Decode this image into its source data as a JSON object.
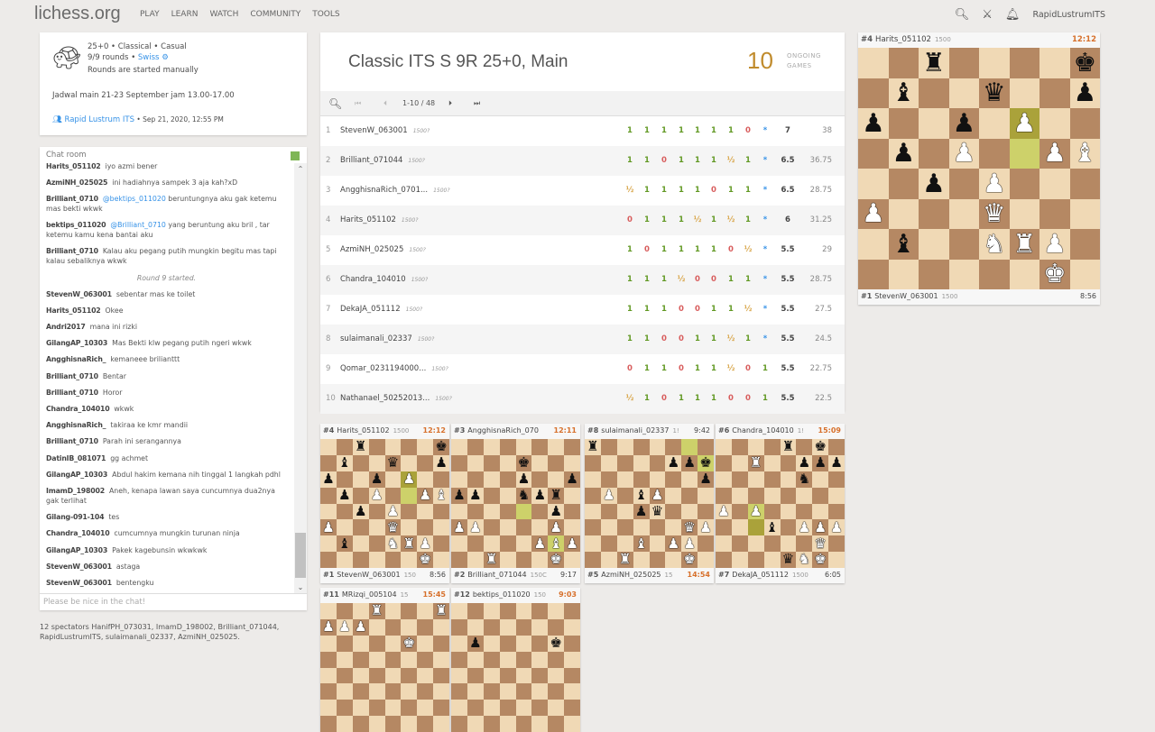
{
  "header": {
    "logo": "lichess.org",
    "nav": [
      "PLAY",
      "LEARN",
      "WATCH",
      "COMMUNITY",
      "TOOLS"
    ],
    "user": "RapidLustrumITS"
  },
  "info": {
    "line1": "25+0 • Classical • Casual",
    "rounds": "9/9 rounds • ",
    "swiss": "Swiss",
    "line3": "Rounds are started manually",
    "desc": "Jadwal main 21-23 September jam 13.00-17.00",
    "team": "Rapid Lustrum ITS",
    "date": " • Sep 21, 2020, 12:55 PM"
  },
  "chat": {
    "title": "Chat room",
    "placeholder": "Please be nice in the chat!",
    "messages": [
      {
        "u": "Harits_051102",
        "t": "iyo azmi bener"
      },
      {
        "u": "AzmiNH_025025",
        "t": "ini hadiahnya sampek 3 aja kah?xD"
      },
      {
        "u": "Brilliant_0710",
        "m": "@bektips_011020",
        "t": " beruntungnya aku gak ketemu mas bekti wkwk"
      },
      {
        "u": "bektips_011020",
        "m": "@Brilliant_0710",
        "t": " yang beruntung aku bril , tar ketemu kamu kena bantai aku"
      },
      {
        "u": "Brilliant_0710",
        "t": "Kalau aku pegang putih mungkin begitu mas tapi kalau sebaliknya wkwk"
      },
      {
        "sys": "Round 9 started."
      },
      {
        "u": "StevenW_063001",
        "t": "sebentar mas ke toilet"
      },
      {
        "u": "Harits_051102",
        "t": "Okee"
      },
      {
        "u": "Andri2017",
        "t": "mana ini rizki"
      },
      {
        "u": "GilangAP_10303",
        "t": "Mas Bekti klw pegang putih ngeri wkwk"
      },
      {
        "u": "AngghisnaRich_",
        "t": "kemaneee brilianttt"
      },
      {
        "u": "Brilliant_0710",
        "t": "Bentar"
      },
      {
        "u": "Brilliant_0710",
        "t": "Horor"
      },
      {
        "u": "Chandra_104010",
        "t": "wkwk"
      },
      {
        "u": "AngghisnaRich_",
        "t": "takiraa ke kmr mandii"
      },
      {
        "u": "Brilliant_0710",
        "t": "Parah ini serangannya"
      },
      {
        "u": "DatinIB_081071",
        "t": "gg achmet"
      },
      {
        "u": "GilangAP_10303",
        "t": "Abdul hakim kemana nih tinggal 1 langkah pdhl"
      },
      {
        "u": "ImamD_198002",
        "t": "Aneh, kenapa lawan saya cuncumnya dua2nya gak terlihat"
      },
      {
        "u": "Gilang-091-104",
        "t": "tes"
      },
      {
        "u": "Chandra_104010",
        "t": "cumcumnya mungkin turunan ninja"
      },
      {
        "u": "GilangAP_10303",
        "t": "Pakek kagebunsin wkwkwk"
      },
      {
        "u": "StevenW_063001",
        "t": "astaga"
      },
      {
        "u": "StevenW_063001",
        "t": "bentengku"
      }
    ]
  },
  "spectators": "12 spectators HanifPH_073031, ImamD_198002, Brilliant_071044, RapidLustrumITS, sulaimanali_02337, AzmiNH_025025.",
  "tournament": {
    "title": "Classic ITS S 9R 25+0, Main",
    "ongoing": "10",
    "ongoing_label1": "ONGOING",
    "ongoing_label2": "GAMES",
    "pager": "1-10 / 48"
  },
  "standings": [
    {
      "rank": "1",
      "name": "StevenW_063001",
      "rating": "1500?",
      "res": [
        "1",
        "1",
        "1",
        "1",
        "1",
        "1",
        "1",
        "0",
        "*"
      ],
      "total": "7",
      "tb": "38"
    },
    {
      "rank": "2",
      "name": "Brilliant_071044",
      "rating": "1500?",
      "res": [
        "1",
        "1",
        "0",
        "1",
        "1",
        "1",
        "½",
        "1",
        "*"
      ],
      "total": "6.5",
      "tb": "36.75"
    },
    {
      "rank": "3",
      "name": "AngghisnaRich_0701...",
      "rating": "1500?",
      "res": [
        "½",
        "1",
        "1",
        "1",
        "1",
        "0",
        "1",
        "1",
        "*"
      ],
      "total": "6.5",
      "tb": "28.75"
    },
    {
      "rank": "4",
      "name": "Harits_051102",
      "rating": "1500?",
      "res": [
        "0",
        "1",
        "1",
        "1",
        "½",
        "1",
        "½",
        "1",
        "*"
      ],
      "total": "6",
      "tb": "31.25"
    },
    {
      "rank": "5",
      "name": "AzmiNH_025025",
      "rating": "1500?",
      "res": [
        "1",
        "0",
        "1",
        "1",
        "1",
        "1",
        "0",
        "½",
        "*"
      ],
      "total": "5.5",
      "tb": "29"
    },
    {
      "rank": "6",
      "name": "Chandra_104010",
      "rating": "1500?",
      "res": [
        "1",
        "1",
        "1",
        "½",
        "0",
        "0",
        "1",
        "1",
        "*"
      ],
      "total": "5.5",
      "tb": "28.75"
    },
    {
      "rank": "7",
      "name": "DekaJA_051112",
      "rating": "1500?",
      "res": [
        "1",
        "1",
        "1",
        "0",
        "0",
        "1",
        "1",
        "½",
        "*"
      ],
      "total": "5.5",
      "tb": "27.5"
    },
    {
      "rank": "8",
      "name": "sulaimanali_02337",
      "rating": "1500?",
      "res": [
        "1",
        "1",
        "0",
        "0",
        "1",
        "1",
        "½",
        "1",
        "*"
      ],
      "total": "5.5",
      "tb": "24.5"
    },
    {
      "rank": "9",
      "name": "Qomar_0231194000...",
      "rating": "1500?",
      "res": [
        "0",
        "1",
        "1",
        "0",
        "1",
        "1",
        "½",
        "0",
        "1"
      ],
      "total": "5.5",
      "tb": "22.75"
    },
    {
      "rank": "10",
      "name": "Nathanael_50252013...",
      "rating": "1500?",
      "res": [
        "½",
        "1",
        "0",
        "1",
        "1",
        "1",
        "0",
        "0",
        "1"
      ],
      "total": "5.5",
      "tb": "22.5"
    }
  ],
  "featured": {
    "top": {
      "rank": "#4",
      "name": "Harits_051102",
      "rating": "1500",
      "clock": "12:12",
      "active": true
    },
    "bottom": {
      "rank": "#1",
      "name": "StevenW_063001",
      "rating": "1500",
      "clock": "8:56",
      "active": false
    },
    "fen": "2r4k/1b2q2p/p2p1P2/1p1P2PB/2p1P3/P3Q3/1b2NRP1/6K1",
    "hl": [
      "f6",
      "f5"
    ]
  },
  "games": [
    {
      "top": {
        "rank": "#4",
        "name": "Harits_051102",
        "rating": "1500",
        "clock": "12:12",
        "active": true
      },
      "bottom": {
        "rank": "#1",
        "name": "StevenW_063001",
        "rating": "150",
        "clock": "8:56",
        "active": false
      },
      "fen": "2r4k/1b2q2p/p2p1P2/1p1P2PB/2p1P3/P3Q3/1b2NRP1/6K1",
      "hl": [
        "f6",
        "f5"
      ]
    },
    {
      "top": {
        "rank": "#3",
        "name": "AngghisnaRich_070",
        "rating": "",
        "clock": "12:11",
        "active": true
      },
      "bottom": {
        "rank": "#2",
        "name": "Brilliant_071044",
        "rating": "150C",
        "clock": "9:17",
        "active": false
      },
      "fen": "8/4k3/4p2p/pp2npr1/6p1/PP4P1/5PBP/2R3K1",
      "hl": [
        "e4",
        "g2"
      ]
    },
    {
      "top": {
        "rank": "#8",
        "name": "sulaimanali_02337",
        "rating": "1!",
        "clock": "9:42",
        "active": false
      },
      "bottom": {
        "rank": "#5",
        "name": "AzmiNH_025025",
        "rating": "15",
        "clock": "14:54",
        "active": true
      },
      "fen": "r7/5ppk/7p/1P1bP3/3pq3/6QP/3B1PP1/2R3K1",
      "hl": [
        "g8",
        "h7"
      ]
    },
    {
      "top": {
        "rank": "#6",
        "name": "Chandra_104010",
        "rating": "1!",
        "clock": "15:09",
        "active": true
      },
      "bottom": {
        "rank": "#7",
        "name": "DekaJA_051112",
        "rating": "1500",
        "clock": "6:05",
        "active": false
      },
      "fen": "4r1k1/2R2ppp/5n2/8/P1P5/3b1PPP/6Q1/4qNK1",
      "hl": [
        "c4",
        "c3"
      ]
    },
    {
      "top": {
        "rank": "#11",
        "name": "MRizqi_005104",
        "rating": "15",
        "clock": "15:45",
        "active": true
      },
      "fen": "3R3R/PPP5/5K2/8/8/8/8/8",
      "hl": []
    },
    {
      "top": {
        "rank": "#12",
        "name": "bektips_011020",
        "rating": "150",
        "clock": "9:03",
        "active": true
      },
      "fen": "8/8/1p4k1/8/8/8/8/8",
      "hl": []
    }
  ],
  "colors": {
    "win": "#629924",
    "loss": "#d85d5d",
    "draw": "#d8a64a",
    "pending": "#3692e7"
  }
}
